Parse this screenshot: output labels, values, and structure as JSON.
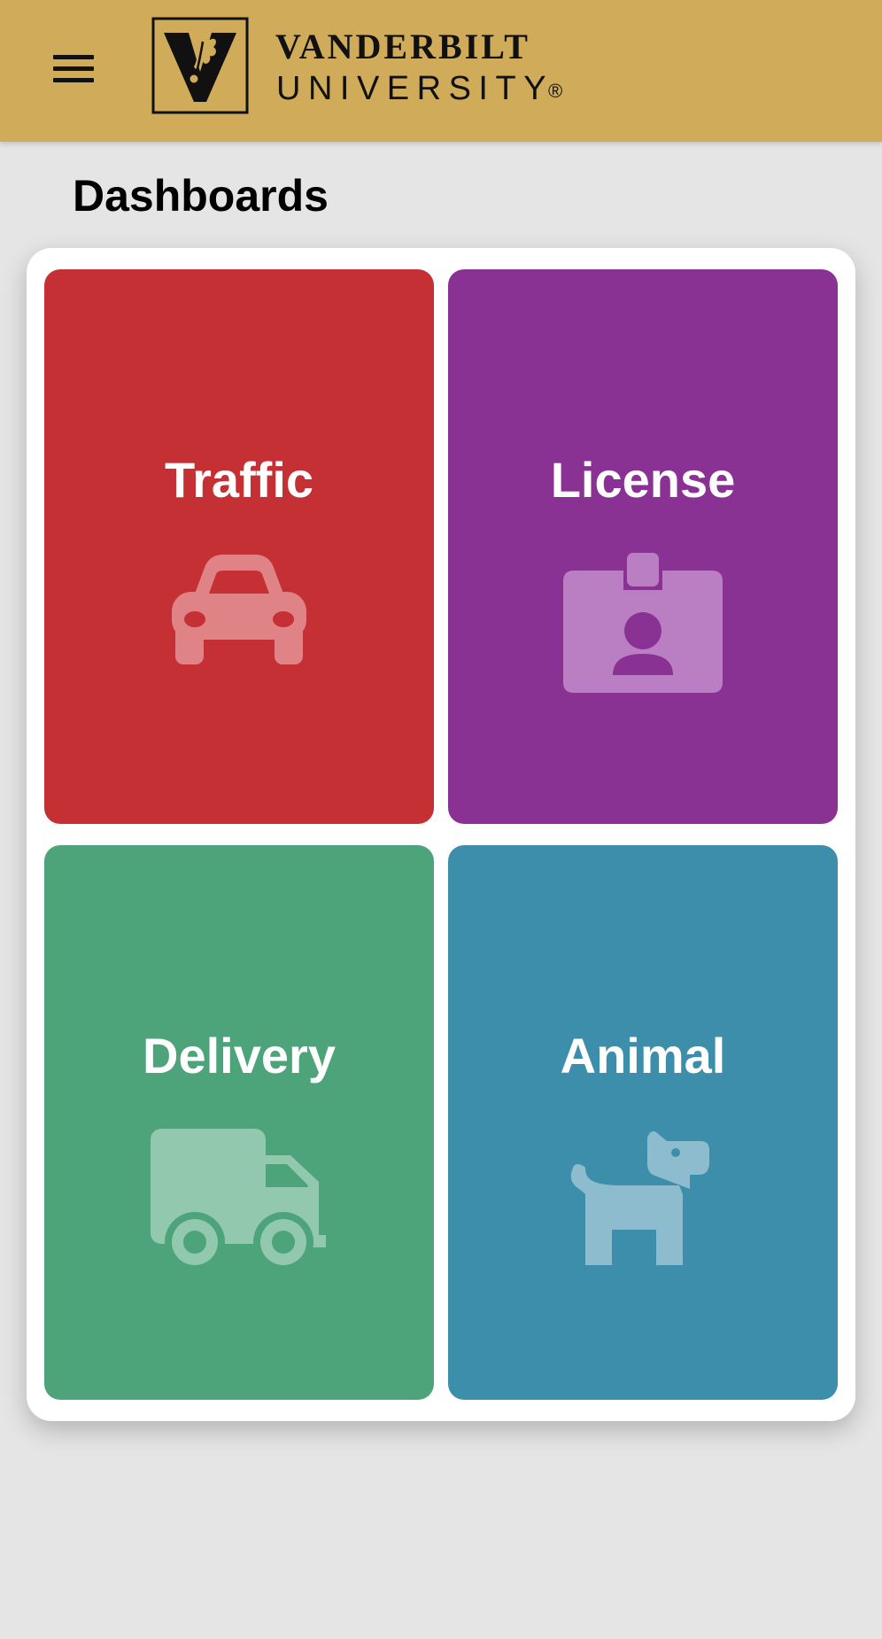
{
  "header": {
    "menu_icon": "hamburger-menu-icon",
    "logo": {
      "line1": "VANDERBILT",
      "line2": "UNIVERSITY",
      "registered": "®",
      "mark_icon": "vanderbilt-v-oak-leaf-icon"
    },
    "background_color": "#cfab5a"
  },
  "page": {
    "title": "Dashboards"
  },
  "tiles": [
    {
      "label": "Traffic",
      "icon": "car-icon",
      "color": "#c43034"
    },
    {
      "label": "License",
      "icon": "id-badge-icon",
      "color": "#8a3194"
    },
    {
      "label": "Delivery",
      "icon": "truck-icon",
      "color": "#4da37a"
    },
    {
      "label": "Animal",
      "icon": "dog-icon",
      "color": "#3c8eaa"
    }
  ]
}
